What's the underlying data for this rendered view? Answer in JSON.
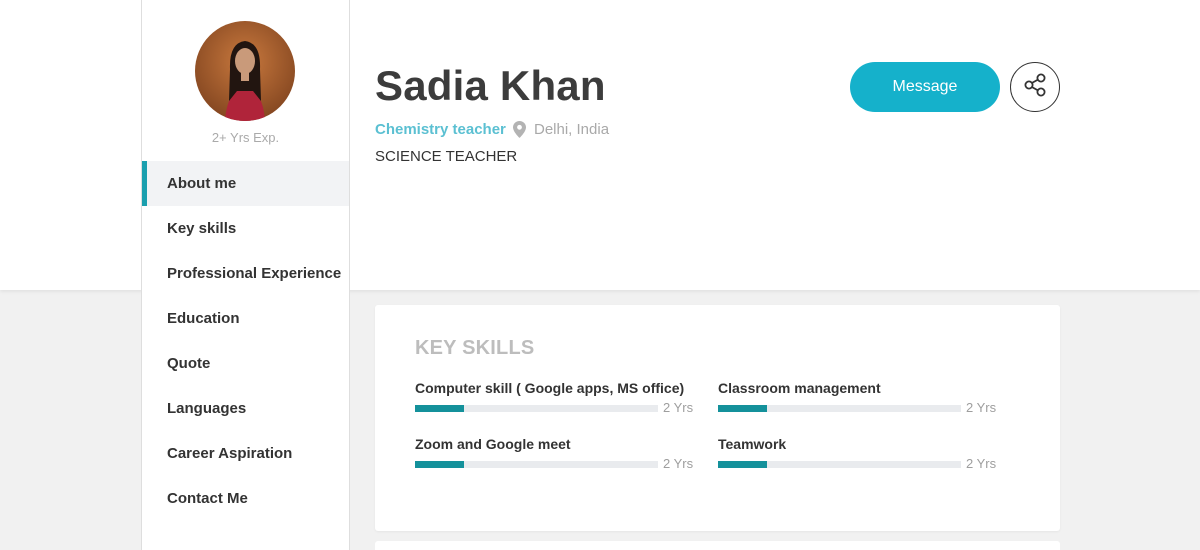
{
  "profile": {
    "name": "Sadia Khan",
    "role": "Chemistry teacher",
    "location": "Delhi, India",
    "headline": "SCIENCE TEACHER",
    "experience": "2+ Yrs Exp."
  },
  "actions": {
    "message_label": "Message",
    "share_icon": "share-icon"
  },
  "sidebar": {
    "items": [
      {
        "label": "About me",
        "active": true
      },
      {
        "label": "Key skills"
      },
      {
        "label": "Professional Experience"
      },
      {
        "label": "Education"
      },
      {
        "label": "Quote"
      },
      {
        "label": "Languages"
      },
      {
        "label": "Career Aspiration"
      },
      {
        "label": "Contact Me"
      }
    ]
  },
  "key_skills": {
    "title": "KEY SKILLS",
    "skills": [
      {
        "name": "Computer skill ( Google apps, MS office)",
        "years": "2 Yrs",
        "level": 0.2
      },
      {
        "name": "Classroom management",
        "years": "2 Yrs",
        "level": 0.2
      },
      {
        "name": "Zoom and Google meet",
        "years": "2 Yrs",
        "level": 0.2
      },
      {
        "name": "Teamwork",
        "years": "2 Yrs",
        "level": 0.2
      }
    ]
  },
  "colors": {
    "accent": "#15b1cb",
    "active_bar": "#1b9fae",
    "skill_fill": "#14919b",
    "role_text": "#5bc0d2"
  }
}
